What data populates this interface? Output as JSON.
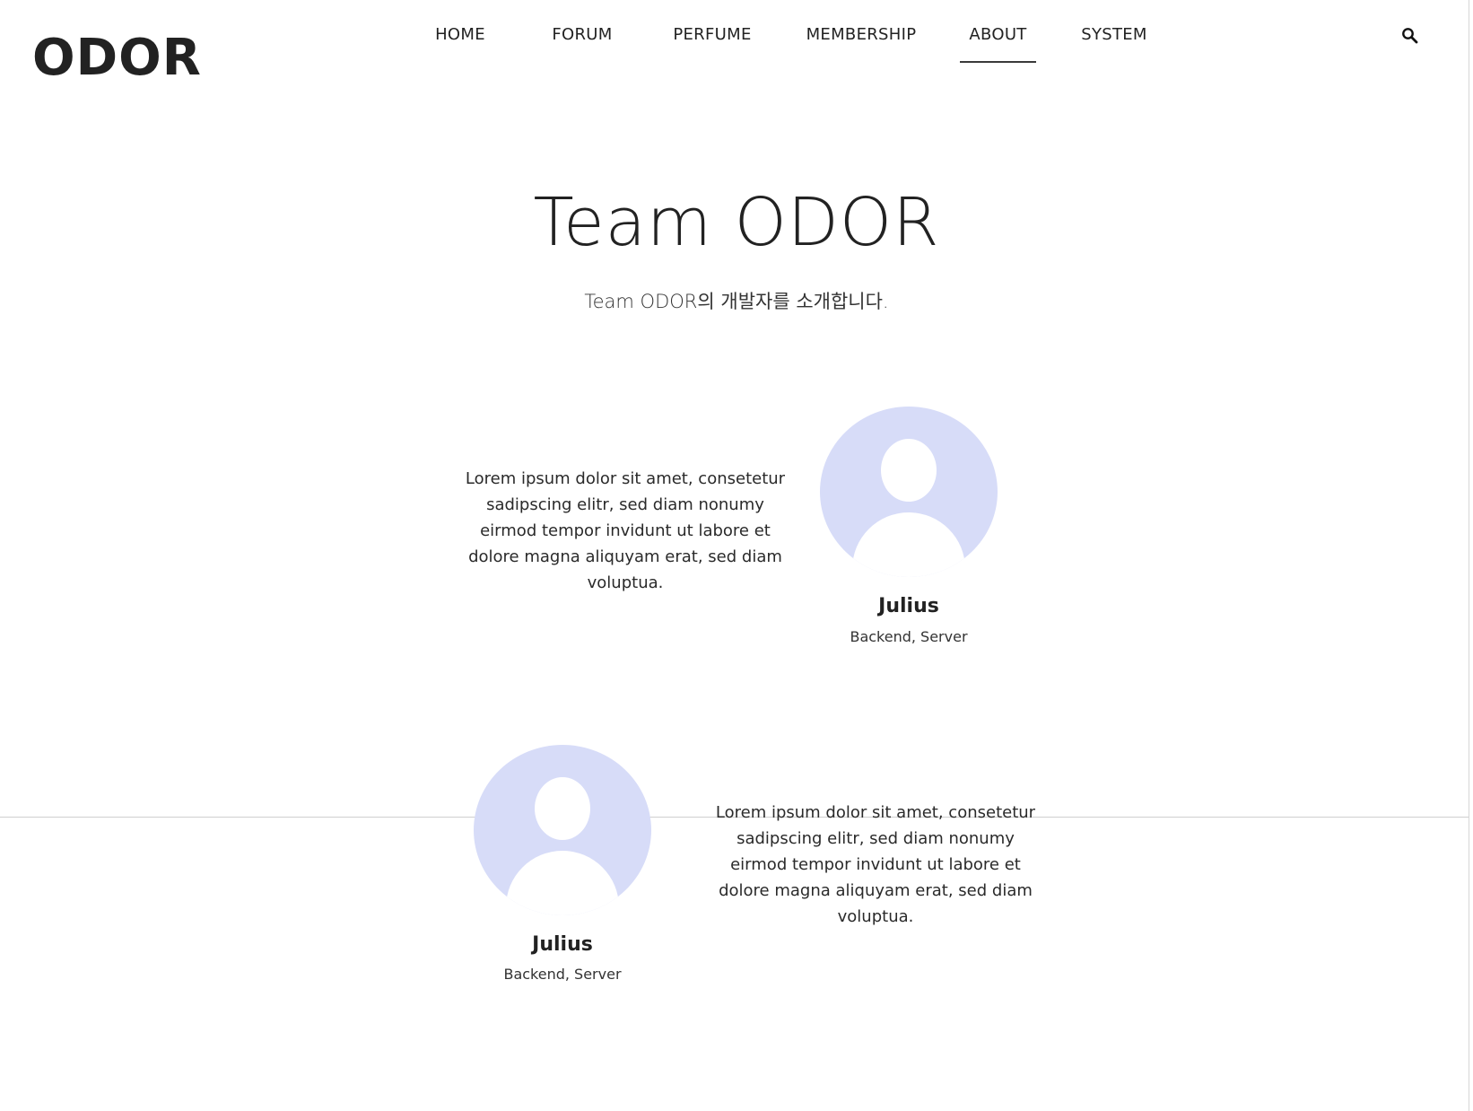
{
  "header": {
    "logo": "ODOR",
    "nav": [
      {
        "label": "HOME",
        "active": false
      },
      {
        "label": "FORUM",
        "active": false
      },
      {
        "label": "PERFUME",
        "active": false
      },
      {
        "label": "MEMBERSHIP",
        "active": false
      },
      {
        "label": "ABOUT",
        "active": true
      },
      {
        "label": "SYSTEM",
        "active": false
      }
    ],
    "search_icon": "search-icon"
  },
  "main": {
    "title": "Team ODOR",
    "subtitle": "Team ODOR의 개발자를 소개합니다.",
    "members": [
      {
        "description": "Lorem ipsum dolor sit amet, consetetur sadipscing elitr, sed diam nonumy eirmod tempor invidunt ut labore et dolore magna aliquyam erat, sed diam voluptua.",
        "name": "Julius",
        "role": "Backend, Server",
        "avatar_icon": "user-avatar-icon"
      },
      {
        "description": "Lorem ipsum dolor sit amet, consetetur sadipscing elitr, sed diam nonumy eirmod tempor invidunt ut labore et dolore magna aliquyam erat, sed diam voluptua.",
        "name": "Julius",
        "role": "Backend, Server",
        "avatar_icon": "user-avatar-icon"
      }
    ]
  },
  "colors": {
    "text": "#222222",
    "avatar_background": "#d7dcf8",
    "avatar_silhouette": "#ffffff",
    "page_background": "#ffffff"
  }
}
